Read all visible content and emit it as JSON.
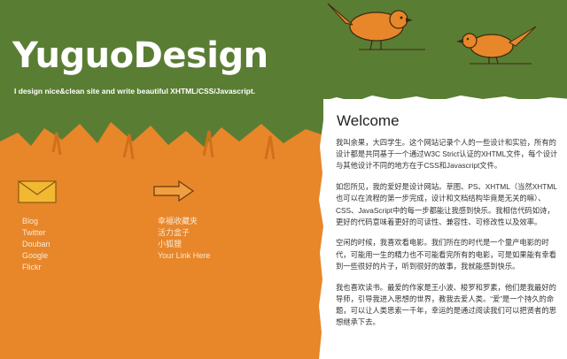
{
  "header": {
    "site_title": "YuguoDesign",
    "tagline": "I design nice&clean site and write beautiful XHTML/CSS/Javascript."
  },
  "links_left": [
    "Blog",
    "Twitter",
    "Douban",
    "Google",
    "Flickr"
  ],
  "links_right": [
    "幸福收藏夹",
    "活力盒子",
    "小狐狸",
    "Your Link Here"
  ],
  "content": {
    "heading": "Welcome",
    "paragraphs": [
      "我叫余果，大四学生。这个网站记录个人的一些设计和实验，所有的设计都是共同基于一个通过W3C Strict认证的XHTML文件，每个设计与其他设计不同的地方在于CSS和Javascript文件。",
      "如您所见，我的爱好是设计网站。草图、PS、XHTML（当然XHTML也可以在流程的第一步完成，设计和文档结构毕竟是无关的嘛）、CSS、JavaScript中的每一步都能让我感到快乐。我相信代码如诗，更好的代码意味着更好的可读性、兼容性、可修改性以及效率。",
      "空闲的时候，我喜欢看电影。我们所在的时代是一个量产电影的时代，可能用一生的精力也不可能看完所有的电影，可是如果能有幸看到一些很好的片子，听到很好的故事，我就能感到快乐。",
      "我也喜欢读书。最爱的作家是王小波、梭罗和罗素，他们是我最好的导师，引导我进入思想的世界，教我去爱人类。“爱”是一个持久的命题，可以让人类思索一千年，幸运的是通过阅读我们可以把贤者的思想继承下去。"
    ]
  },
  "colors": {
    "green": "#5a7d34",
    "orange": "#e8862a",
    "white": "#ffffff"
  }
}
